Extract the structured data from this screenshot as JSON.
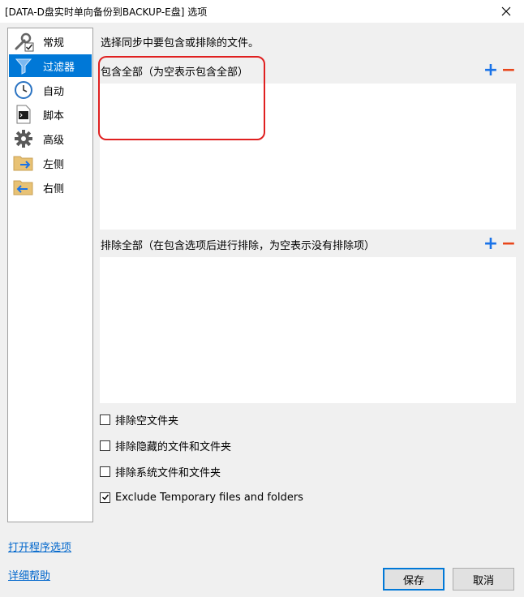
{
  "window": {
    "title": "[DATA-D盘实时单向备份到BACKUP-E盘] 选项"
  },
  "sidebar": {
    "items": [
      {
        "label": "常规",
        "icon": "wrench-check-icon",
        "selected": false
      },
      {
        "label": "过滤器",
        "icon": "funnel-icon",
        "selected": true
      },
      {
        "label": "自动",
        "icon": "clock-icon",
        "selected": false
      },
      {
        "label": "脚本",
        "icon": "script-file-icon",
        "selected": false
      },
      {
        "label": "高级",
        "icon": "gear-icon",
        "selected": false
      },
      {
        "label": "左侧",
        "icon": "folder-arrow-right-icon",
        "selected": false
      },
      {
        "label": "右侧",
        "icon": "folder-arrow-left-icon",
        "selected": false
      }
    ]
  },
  "main": {
    "description": "选择同步中要包含或排除的文件。",
    "include": {
      "label": "包含全部（为空表示包含全部）",
      "add": "+",
      "remove": "−"
    },
    "exclude": {
      "label": "排除全部（在包含选项后进行排除，为空表示没有排除项）",
      "add": "+",
      "remove": "−"
    },
    "checkboxes": [
      {
        "label": "排除空文件夹",
        "checked": false
      },
      {
        "label": "排除隐藏的文件和文件夹",
        "checked": false
      },
      {
        "label": "排除系统文件和文件夹",
        "checked": false
      },
      {
        "label": "Exclude Temporary files and folders",
        "checked": true
      }
    ]
  },
  "footer": {
    "open_options_link": "打开程序选项",
    "help_link": "详细帮助",
    "save_label": "保存",
    "cancel_label": "取消"
  },
  "colors": {
    "selected": "#0078d7",
    "plus": "#1a73e8",
    "minus": "#e8461a",
    "highlight": "#e02020",
    "link": "#0066cc"
  }
}
